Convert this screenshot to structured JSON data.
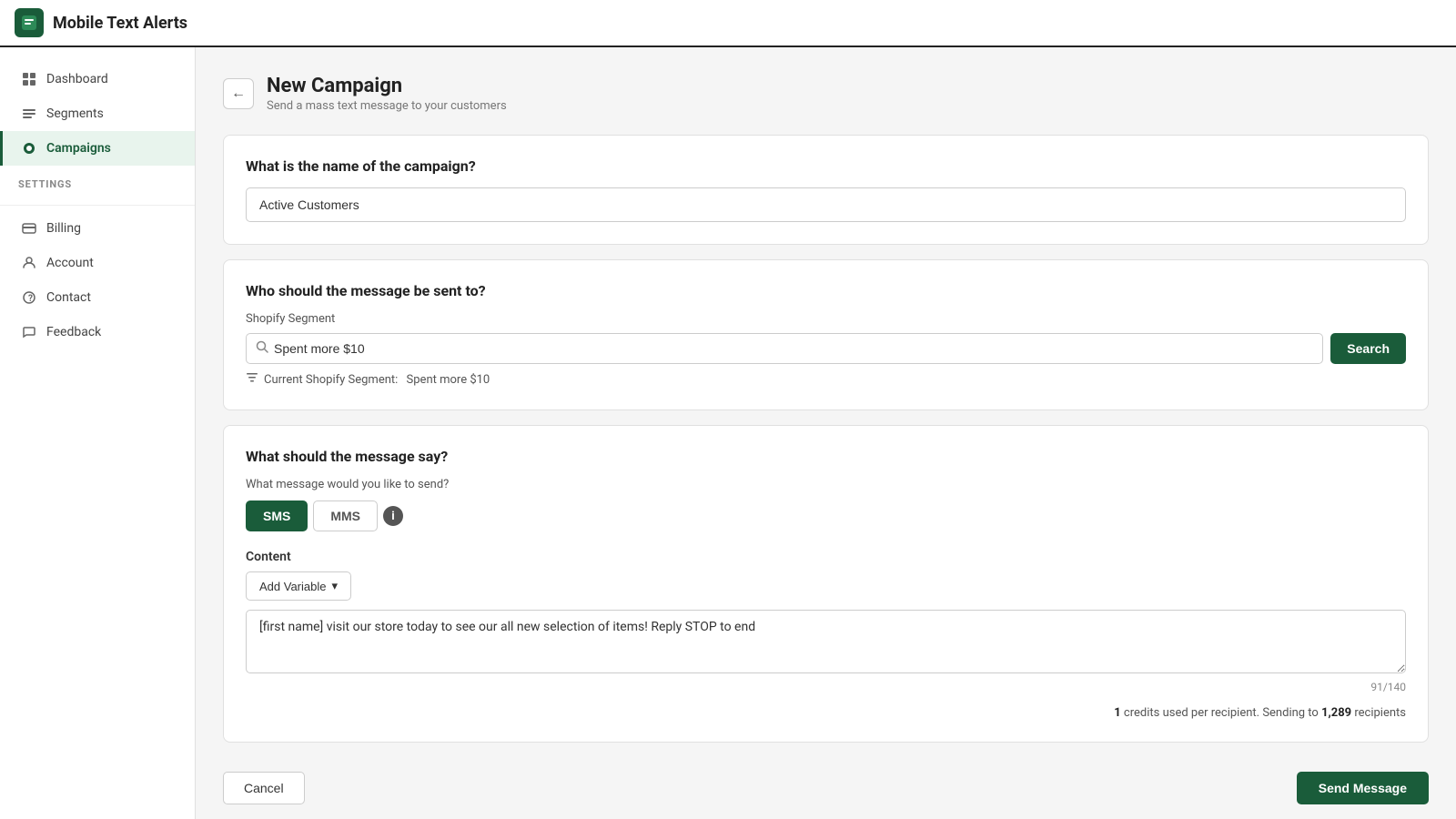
{
  "app": {
    "title": "Mobile Text Alerts",
    "logo_char": "📱"
  },
  "sidebar": {
    "nav_items": [
      {
        "id": "dashboard",
        "label": "Dashboard",
        "icon": "🏠",
        "active": false
      },
      {
        "id": "segments",
        "label": "Segments",
        "icon": "☰",
        "active": false
      },
      {
        "id": "campaigns",
        "label": "Campaigns",
        "icon": "💬",
        "active": true
      }
    ],
    "settings_label": "SETTINGS",
    "settings_items": [
      {
        "id": "billing",
        "label": "Billing",
        "icon": "🗂"
      },
      {
        "id": "account",
        "label": "Account",
        "icon": "⚙"
      },
      {
        "id": "contact",
        "label": "Contact",
        "icon": "❓"
      },
      {
        "id": "feedback",
        "label": "Feedback",
        "icon": "📣"
      }
    ]
  },
  "page": {
    "title": "New Campaign",
    "subtitle": "Send a mass text message to your customers"
  },
  "form": {
    "campaign_name_label": "What is the name of the campaign?",
    "campaign_name_value": "Active Customers",
    "recipient_label": "Who should the message be sent to?",
    "shopify_segment_label": "Shopify Segment",
    "search_placeholder": "Spent more $10",
    "search_value": "Spent more $10",
    "search_button": "Search",
    "current_segment_prefix": "Current Shopify Segment:",
    "current_segment_value": "Spent more $10",
    "message_label": "What should the message say?",
    "message_type_prompt": "What message would you like to send?",
    "sms_label": "SMS",
    "mms_label": "MMS",
    "content_label": "Content",
    "add_variable_label": "Add Variable",
    "message_text": "[first name] visit our store today to see our all new selection of items! Reply STOP to end",
    "char_count": "91/140",
    "credits_text_pre": "1",
    "credits_text_mid": " credits used per recipient. Sending to ",
    "recipients": "1,289",
    "credits_text_post": " recipients"
  },
  "actions": {
    "cancel_label": "Cancel",
    "send_label": "Send Message"
  }
}
